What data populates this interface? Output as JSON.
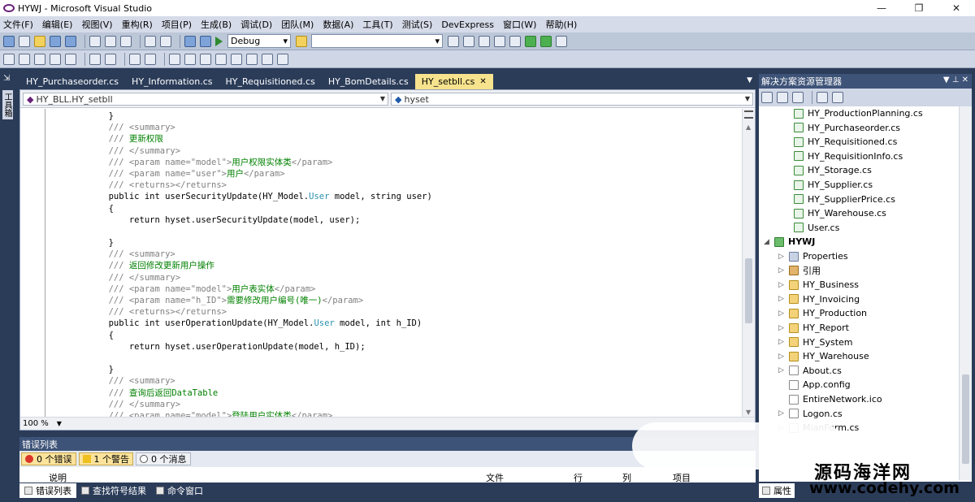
{
  "window": {
    "title": "HYWJ - Microsoft Visual Studio",
    "controls": [
      "—",
      "❐",
      "✕"
    ]
  },
  "menu": [
    "文件(F)",
    "编辑(E)",
    "视图(V)",
    "重构(R)",
    "项目(P)",
    "生成(B)",
    "调试(D)",
    "团队(M)",
    "数据(A)",
    "工具(T)",
    "测试(S)",
    "DevExpress",
    "窗口(W)",
    "帮助(H)"
  ],
  "toolbar": {
    "config_value": "Debug",
    "platform_value": ""
  },
  "toolbox": {
    "label": "工具箱"
  },
  "editor_tabs": [
    {
      "label": "HY_Purchaseorder.cs",
      "active": false
    },
    {
      "label": "HY_Information.cs",
      "active": false
    },
    {
      "label": "HY_Requisitioned.cs",
      "active": false
    },
    {
      "label": "HY_BomDetails.cs",
      "active": false
    },
    {
      "label": "HY_setbll.cs",
      "active": true
    }
  ],
  "navbar": {
    "type_value": "HY_BLL.HY_setbll",
    "member_value": "hyset"
  },
  "code_lines": [
    [
      {
        "t": "        }",
        "c": "tx"
      }
    ],
    [
      {
        "t": "        /// ",
        "c": "cm"
      },
      {
        "t": "<summary>",
        "c": "cm"
      }
    ],
    [
      {
        "t": "        /// ",
        "c": "cm"
      },
      {
        "t": "更新权限",
        "c": "gr"
      }
    ],
    [
      {
        "t": "        /// ",
        "c": "cm"
      },
      {
        "t": "</summary>",
        "c": "cm"
      }
    ],
    [
      {
        "t": "        /// ",
        "c": "cm"
      },
      {
        "t": "<param name=\"model\">",
        "c": "cm"
      },
      {
        "t": "用户权限实体类",
        "c": "gr"
      },
      {
        "t": "</param>",
        "c": "cm"
      }
    ],
    [
      {
        "t": "        /// ",
        "c": "cm"
      },
      {
        "t": "<param name=\"user\">",
        "c": "cm"
      },
      {
        "t": "用户",
        "c": "gr"
      },
      {
        "t": "</param>",
        "c": "cm"
      }
    ],
    [
      {
        "t": "        /// ",
        "c": "cm"
      },
      {
        "t": "<returns></returns>",
        "c": "cm"
      }
    ],
    [
      {
        "t": "        public int userSecurityUpdate(HY_Model.",
        "c": "tx"
      },
      {
        "t": "User",
        "c": "ty"
      },
      {
        "t": " model, string user)",
        "c": "tx"
      }
    ],
    [
      {
        "t": "        {",
        "c": "tx"
      }
    ],
    [
      {
        "t": "            return hyset.userSecurityUpdate(model, user);",
        "c": "tx"
      }
    ],
    [
      {
        "t": "",
        "c": "tx"
      }
    ],
    [
      {
        "t": "        }",
        "c": "tx"
      }
    ],
    [
      {
        "t": "        /// ",
        "c": "cm"
      },
      {
        "t": "<summary>",
        "c": "cm"
      }
    ],
    [
      {
        "t": "        /// ",
        "c": "cm"
      },
      {
        "t": "返回修改更新用户操作",
        "c": "gr"
      }
    ],
    [
      {
        "t": "        /// ",
        "c": "cm"
      },
      {
        "t": "</summary>",
        "c": "cm"
      }
    ],
    [
      {
        "t": "        /// ",
        "c": "cm"
      },
      {
        "t": "<param name=\"model\">",
        "c": "cm"
      },
      {
        "t": "用户表实体",
        "c": "gr"
      },
      {
        "t": "</param>",
        "c": "cm"
      }
    ],
    [
      {
        "t": "        /// ",
        "c": "cm"
      },
      {
        "t": "<param name=\"h_ID\">",
        "c": "cm"
      },
      {
        "t": "需要修改用户编号(唯一)",
        "c": "gr"
      },
      {
        "t": "</param>",
        "c": "cm"
      }
    ],
    [
      {
        "t": "        /// ",
        "c": "cm"
      },
      {
        "t": "<returns></returns>",
        "c": "cm"
      }
    ],
    [
      {
        "t": "        public int userOperationUpdate(HY_Model.",
        "c": "tx"
      },
      {
        "t": "User",
        "c": "ty"
      },
      {
        "t": " model, int h_ID)",
        "c": "tx"
      }
    ],
    [
      {
        "t": "        {",
        "c": "tx"
      }
    ],
    [
      {
        "t": "            return hyset.userOperationUpdate(model, h_ID);",
        "c": "tx"
      }
    ],
    [
      {
        "t": "",
        "c": "tx"
      }
    ],
    [
      {
        "t": "        }",
        "c": "tx"
      }
    ],
    [
      {
        "t": "        /// ",
        "c": "cm"
      },
      {
        "t": "<summary>",
        "c": "cm"
      }
    ],
    [
      {
        "t": "        /// ",
        "c": "cm"
      },
      {
        "t": "查询后返回DataTable",
        "c": "gr"
      }
    ],
    [
      {
        "t": "        /// ",
        "c": "cm"
      },
      {
        "t": "</summary>",
        "c": "cm"
      }
    ],
    [
      {
        "t": "        /// ",
        "c": "cm"
      },
      {
        "t": "<param name=\"model\">",
        "c": "cm"
      },
      {
        "t": "登陆用户实体类",
        "c": "gr"
      },
      {
        "t": "</param>",
        "c": "cm"
      }
    ]
  ],
  "zoom": "100 %",
  "error_list": {
    "title": "错误列表",
    "errors_label": "0 个错误",
    "warnings_label": "1 个警告",
    "messages_label": "0 个消息",
    "columns": [
      "说明",
      "文件",
      "行",
      "列",
      "项目"
    ]
  },
  "bottom_tabs": [
    "错误列表",
    "查找符号结果",
    "命令窗口"
  ],
  "solution_explorer": {
    "title": "解决方案资源管理器",
    "items": [
      {
        "label": "HY_ProductionPlanning.cs",
        "kind": "cs",
        "level": 2
      },
      {
        "label": "HY_Purchaseorder.cs",
        "kind": "cs",
        "level": 2
      },
      {
        "label": "HY_Requisitioned.cs",
        "kind": "cs",
        "level": 2
      },
      {
        "label": "HY_RequisitionInfo.cs",
        "kind": "cs",
        "level": 2
      },
      {
        "label": "HY_Storage.cs",
        "kind": "cs",
        "level": 2
      },
      {
        "label": "HY_Supplier.cs",
        "kind": "cs",
        "level": 2
      },
      {
        "label": "HY_SupplierPrice.cs",
        "kind": "cs",
        "level": 2
      },
      {
        "label": "HY_Warehouse.cs",
        "kind": "cs",
        "level": 2
      },
      {
        "label": "User.cs",
        "kind": "cs",
        "level": 2
      },
      {
        "label": "HYWJ",
        "kind": "proj",
        "level": 0
      },
      {
        "label": "Properties",
        "kind": "props",
        "level": 1
      },
      {
        "label": "引用",
        "kind": "ref",
        "level": 1
      },
      {
        "label": "HY_Business",
        "kind": "folder",
        "level": 1
      },
      {
        "label": "HY_Invoicing",
        "kind": "folder",
        "level": 1
      },
      {
        "label": "HY_Production",
        "kind": "folder",
        "level": 1
      },
      {
        "label": "HY_Report",
        "kind": "folder",
        "level": 1
      },
      {
        "label": "HY_System",
        "kind": "folder",
        "level": 1
      },
      {
        "label": "HY_Warehouse",
        "kind": "folder",
        "level": 1
      },
      {
        "label": "About.cs",
        "kind": "file",
        "level": 1
      },
      {
        "label": "App.config",
        "kind": "file",
        "level": 1
      },
      {
        "label": "EntireNetwork.ico",
        "kind": "file",
        "level": 1
      },
      {
        "label": "Logon.cs",
        "kind": "file",
        "level": 1
      },
      {
        "label": "MianForm.cs",
        "kind": "file",
        "level": 1
      }
    ],
    "bottom_tab": "属性"
  },
  "watermark": {
    "line1": "源码海洋网",
    "line2": "www.codehy.com"
  }
}
